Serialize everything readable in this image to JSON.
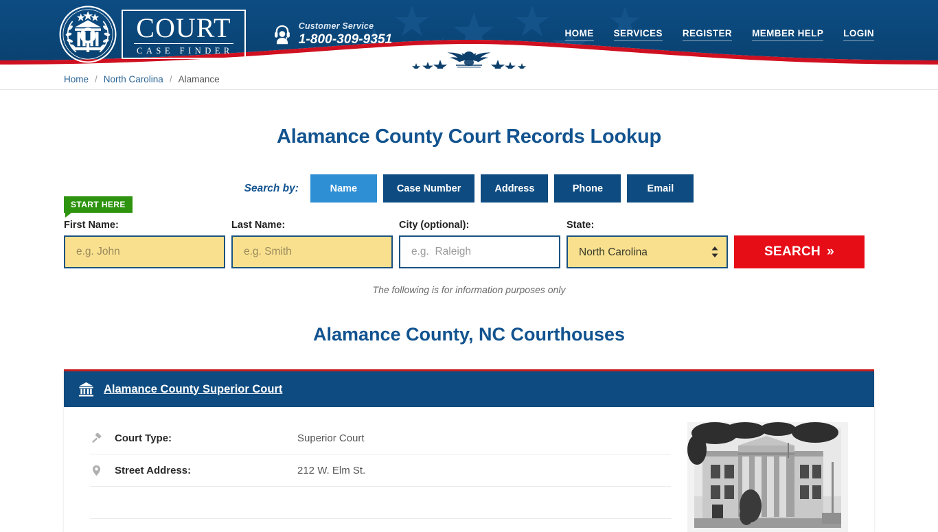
{
  "header": {
    "logo": {
      "main": "COURT",
      "sub": "CASE FINDER",
      "seal_icon": "court-seal-icon"
    },
    "customer_service": {
      "icon": "headset-support-icon",
      "label": "Customer Service",
      "phone": "1-800-309-9351"
    },
    "nav": [
      {
        "label": "HOME"
      },
      {
        "label": "SERVICES"
      },
      {
        "label": "REGISTER"
      },
      {
        "label": "MEMBER HELP"
      },
      {
        "label": "LOGIN"
      }
    ],
    "emblem_icon": "eagle-stars-emblem"
  },
  "breadcrumb": {
    "items": [
      {
        "label": "Home",
        "link": true
      },
      {
        "label": "North Carolina",
        "link": true
      },
      {
        "label": "Alamance",
        "link": false
      }
    ],
    "separator": "/"
  },
  "main": {
    "page_title": "Alamance County Court Records Lookup",
    "search_by_label": "Search by:",
    "tabs": [
      {
        "label": "Name",
        "active": true
      },
      {
        "label": "Case Number",
        "active": false
      },
      {
        "label": "Address",
        "active": false
      },
      {
        "label": "Phone",
        "active": false
      },
      {
        "label": "Email",
        "active": false
      }
    ],
    "start_here_badge": "START HERE",
    "form": {
      "first_name": {
        "label": "First Name:",
        "value": "",
        "placeholder": "e.g. John"
      },
      "last_name": {
        "label": "Last Name:",
        "value": "",
        "placeholder": "e.g. Smith"
      },
      "city": {
        "label": "City (optional):",
        "value": "",
        "placeholder": "e.g.  Raleigh"
      },
      "state": {
        "label": "State:",
        "selected": "North Carolina",
        "stepper_icon": "updown-chevron-icon"
      },
      "search_button": {
        "label": "SEARCH",
        "chevron": "»"
      }
    },
    "disclaimer": "The following is for information purposes only",
    "section_title": "Alamance County, NC Courthouses"
  },
  "court_card": {
    "icon": "courthouse-bank-icon",
    "title": "Alamance County Superior Court",
    "photo_alt": "Alamance County Courthouse historic photo",
    "rows": [
      {
        "icon": "gavel-icon",
        "label": "Court Type:",
        "value": "Superior Court"
      },
      {
        "icon": "map-pin-icon",
        "label": "Street Address:",
        "value": "212 W. Elm St."
      }
    ]
  },
  "colors": {
    "header_blue": "#0b4a80",
    "accent_red": "#e60d17",
    "tab_active_blue": "#2e8fd4",
    "input_yellow": "#f9e08f",
    "badge_green": "#2e9410",
    "title_blue": "#12538f"
  }
}
